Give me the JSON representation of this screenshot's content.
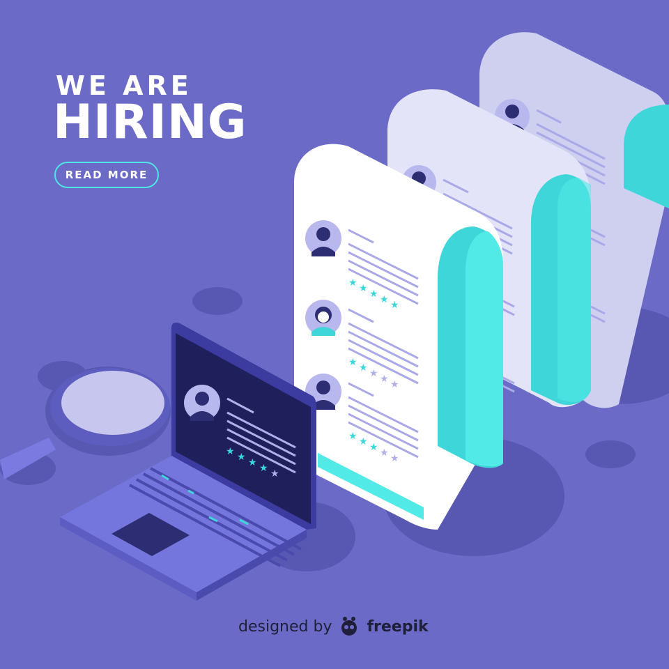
{
  "headline": {
    "line1": "WE ARE",
    "line2": "HIRING"
  },
  "cta": {
    "label": "READ MORE"
  },
  "credit": {
    "prefix": "designed by",
    "brand": "freepik"
  },
  "resume_ratings": [
    {
      "profile": "resume-front",
      "stars_filled": [
        5,
        2,
        3
      ]
    },
    {
      "profile": "laptop-candidate",
      "stars_filled": [
        4
      ]
    }
  ],
  "colors": {
    "background": "#6b6bc7",
    "shadow": "#5858b3",
    "paper": "#ffffff",
    "paper_mid": "#e4e4f8",
    "paper_back": "#cfcff0",
    "teal": "#3fd6d9",
    "teal_light": "#52eae6",
    "line": "#a9a9e8",
    "star_on": "#3fd6d9",
    "star_off": "#b0b0e6",
    "laptop_screen": "#1f1f5c",
    "laptop_body": "#7475dd",
    "laptop_base": "#5c5cc2",
    "avatar_ring": "#b8b8ee",
    "avatar_dark": "#2d2d73",
    "magnifier": "#7a7ae0",
    "lens": "#c6c6ee"
  },
  "icons": [
    "magnifier-icon",
    "laptop-icon",
    "avatar-icon",
    "star-icon",
    "freepik-logo-icon"
  ]
}
